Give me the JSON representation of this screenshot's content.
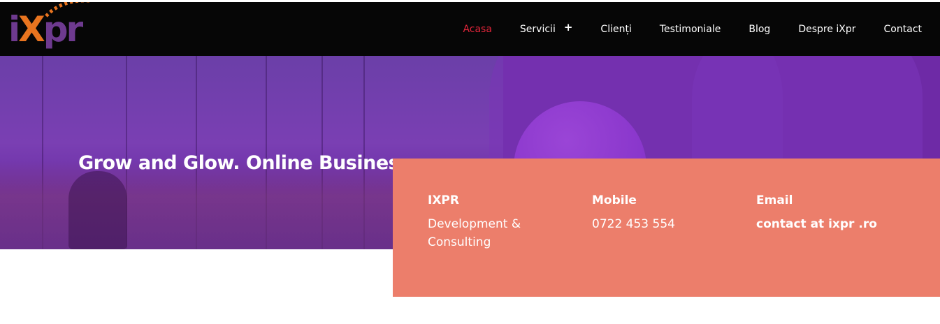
{
  "header": {
    "logo": {
      "text_i": "i",
      "text_x": "X",
      "text_rest": "pr"
    },
    "nav": [
      {
        "label": "Acasa",
        "active": true
      },
      {
        "label": "Servicii",
        "has_submenu": true,
        "submenu_icon": "+"
      },
      {
        "label": "Clienți"
      },
      {
        "label": "Testimoniale"
      },
      {
        "label": "Blog"
      },
      {
        "label": "Despre iXpr"
      },
      {
        "label": "Contact"
      }
    ]
  },
  "hero": {
    "title": "Grow and Glow. Online Business."
  },
  "info": {
    "columns": [
      {
        "label": "IXPR",
        "value": "Development & Consulting"
      },
      {
        "label": "Mobile",
        "value": "0722 453 554"
      },
      {
        "label": "Email",
        "value": "contact at ixpr .ro"
      }
    ]
  },
  "colors": {
    "header_bg": "#060606",
    "nav_active": "#e3253a",
    "hero_purple": "#6e2aa6",
    "info_bg": "#ec7e6b",
    "logo_purple": "#6e3a8f",
    "logo_orange": "#e8741f"
  }
}
